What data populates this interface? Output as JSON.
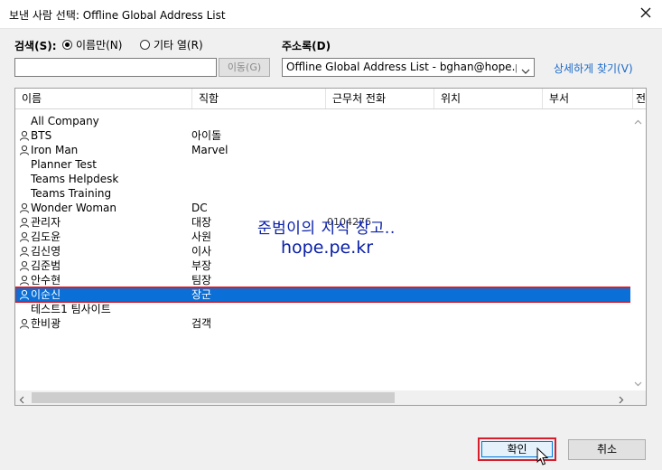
{
  "window": {
    "title": "보낸 사람 선택: Offline Global Address List"
  },
  "search": {
    "label": "검색(S):",
    "option_name_only": "이름만(N)",
    "option_other_columns": "기타 열(R)",
    "selected_option": "name_only",
    "input_value": "",
    "move_button": "이동(G)"
  },
  "address_book": {
    "label": "주소록(D)",
    "selected": "Offline Global Address List - bghan@hope.pe.kr",
    "advanced_link": "상세하게 찾기(V)"
  },
  "list": {
    "columns": [
      "이름",
      "직함",
      "근무처 전화",
      "위치",
      "부서",
      "전"
    ],
    "rows": [
      {
        "name": "All Company",
        "title": "",
        "icon": "none"
      },
      {
        "name": "BTS",
        "title": "아이돌",
        "icon": "person-icon"
      },
      {
        "name": "Iron Man",
        "title": "Marvel",
        "icon": "person-icon"
      },
      {
        "name": "Planner Test",
        "title": "",
        "icon": "none"
      },
      {
        "name": "Teams Helpdesk",
        "title": "",
        "icon": "none"
      },
      {
        "name": "Teams Training",
        "title": "",
        "icon": "none"
      },
      {
        "name": "Wonder Woman",
        "title": "DC",
        "icon": "person-icon"
      },
      {
        "name": "관리자",
        "title": "대장",
        "icon": "person-icon"
      },
      {
        "name": "김도윤",
        "title": "사원",
        "icon": "person-icon"
      },
      {
        "name": "김신영",
        "title": "이사",
        "icon": "person-icon"
      },
      {
        "name": "김준범",
        "title": "부장",
        "icon": "person-icon"
      },
      {
        "name": "안수현",
        "title": "팀장",
        "icon": "person-icon"
      },
      {
        "name": "이순신",
        "title": "장군",
        "icon": "person-icon",
        "selected": true
      },
      {
        "name": "테스트1 팀사이트",
        "title": "",
        "icon": "none"
      },
      {
        "name": "한비광",
        "title": "검객",
        "icon": "person-icon"
      }
    ],
    "overlay_phone_fragment": "0104276"
  },
  "watermark": {
    "line1": "준범이의 지식 창고..",
    "line2": "hope.pe.kr"
  },
  "buttons": {
    "ok": "확인",
    "cancel": "취소"
  },
  "colors": {
    "selection_bg": "#0a70d8",
    "highlight_border": "#d81e2a",
    "link": "#1b6ac9",
    "watermark": "#0a20a8"
  }
}
